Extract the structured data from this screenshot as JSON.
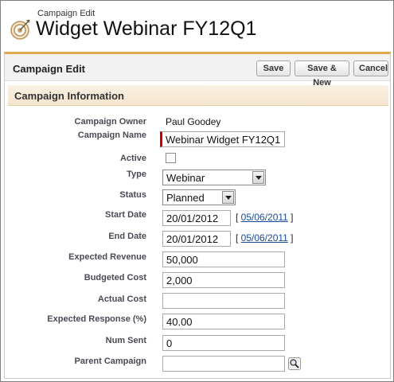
{
  "header": {
    "page_type": "Campaign Edit",
    "title": "Widget Webinar FY12Q1"
  },
  "block": {
    "title": "Campaign Edit",
    "buttons": {
      "save": "Save",
      "save_new": "Save & New",
      "cancel": "Cancel"
    }
  },
  "section": {
    "title": "Campaign Information"
  },
  "fields": {
    "owner": {
      "label": "Campaign Owner",
      "value": "Paul Goodey"
    },
    "name": {
      "label": "Campaign Name",
      "value": "Webinar Widget FY12Q1",
      "required": true
    },
    "active": {
      "label": "Active",
      "checked": false
    },
    "type": {
      "label": "Type",
      "value": "Webinar"
    },
    "status": {
      "label": "Status",
      "value": "Planned"
    },
    "start_date": {
      "label": "Start Date",
      "value": "20/01/2012",
      "today": "05/06/2011"
    },
    "end_date": {
      "label": "End Date",
      "value": "20/01/2012",
      "today": "05/06/2011"
    },
    "expected_revenue": {
      "label": "Expected Revenue",
      "value": "50,000"
    },
    "budgeted_cost": {
      "label": "Budgeted Cost",
      "value": "2,000"
    },
    "actual_cost": {
      "label": "Actual Cost",
      "value": ""
    },
    "expected_response": {
      "label": "Expected Response (%)",
      "value": "40.00"
    },
    "num_sent": {
      "label": "Num Sent",
      "value": "0"
    },
    "parent_campaign": {
      "label": "Parent Campaign",
      "value": ""
    }
  },
  "icons": {
    "page_icon": "target-icon",
    "lookup": "magnifier-icon"
  },
  "colors": {
    "accent": "#e3a94d",
    "section_bg": "#f4e4cc",
    "required": "#cc0000",
    "link": "#1a4a9a"
  }
}
